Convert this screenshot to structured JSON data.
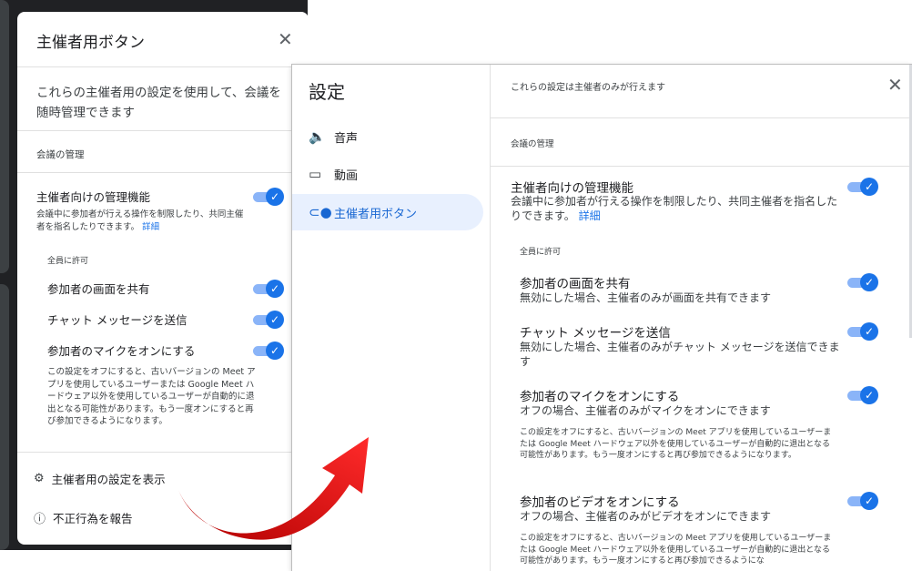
{
  "left_panel": {
    "title": "主催者用ボタン",
    "description": "これらの主催者用の設定を使用して、会議を随時管理できます",
    "section": "会議の管理",
    "host_management": {
      "label": "主催者向けの管理機能",
      "description": "会議中に参加者が行える操作を制限したり、共同主催者を指名したりできます。",
      "link": "詳細"
    },
    "allow_all": "全員に許可",
    "items": [
      {
        "label": "参加者の画面を共有"
      },
      {
        "label": "チャット メッセージを送信"
      },
      {
        "label": "参加者のマイクをオンにする"
      }
    ],
    "mic_warning": "この設定をオフにすると、古いバージョンの Meet アプリを使用しているユーザーまたは Google Meet ハードウェア以外を使用しているユーザーが自動的に退出となる可能性があります。もう一度オンにすると再び参加できるようになります。",
    "show_settings": "主催者用の設定を表示",
    "report_abuse": "不正行為を報告"
  },
  "settings_dialog": {
    "title": "設定",
    "nav": [
      {
        "label": "音声",
        "icon": "speaker-icon"
      },
      {
        "label": "動画",
        "icon": "video-icon"
      },
      {
        "label": "主催者用ボタン",
        "icon": "toggle-icon",
        "active": true
      }
    ],
    "note": "これらの設定は主催者のみが行えます",
    "section": "会議の管理",
    "host_management": {
      "label": "主催者向けの管理機能",
      "description": "会議中に参加者が行える操作を制限したり、共同主催者を指名したりできます。",
      "link": "詳細"
    },
    "allow_all": "全員に許可",
    "items": [
      {
        "label": "参加者の画面を共有",
        "description": "無効にした場合、主催者のみが画面を共有できます"
      },
      {
        "label": "チャット メッセージを送信",
        "description": "無効にした場合、主催者のみがチャット メッセージを送信できます"
      },
      {
        "label": "参加者のマイクをオンにする",
        "description": "オフの場合、主催者のみがマイクをオンにできます",
        "warning": "この設定をオフにすると、古いバージョンの Meet アプリを使用しているユーザーまたは Google Meet ハードウェア以外を使用しているユーザーが自動的に退出となる可能性があります。もう一度オンにすると再び参加できるようになります。"
      },
      {
        "label": "参加者のビデオをオンにする",
        "description": "オフの場合、主催者のみがビデオをオンにできます",
        "warning": "この設定をオフにすると、古いバージョンの Meet アプリを使用しているユーザーまたは Google Meet ハードウェア以外を使用しているユーザーが自動的に退出となる可能性があります。もう一度オンにすると再び参加できるようにな"
      }
    ]
  },
  "colors": {
    "accent": "#1a73e8",
    "toggle_track": "#8ab4f8",
    "arrow": "#e00000",
    "dark_bg": "#202124"
  }
}
